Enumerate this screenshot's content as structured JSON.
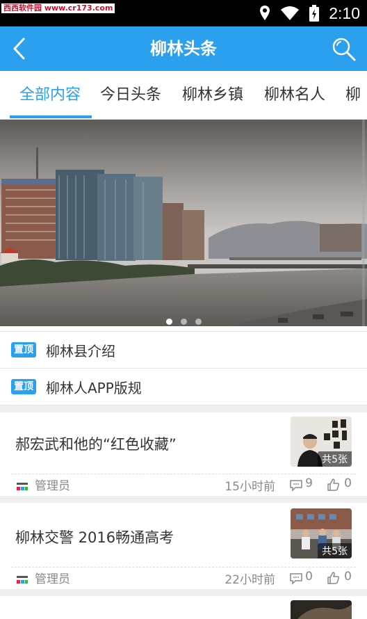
{
  "status_bar": {
    "watermark": "西西软件园 www.cr173.com",
    "time": "2:10"
  },
  "app_bar": {
    "title": "柳林头条",
    "back_icon": "chevron-left-icon",
    "search_icon": "search-icon"
  },
  "tabs": [
    {
      "label": "全部内容",
      "active": true
    },
    {
      "label": "今日头条",
      "active": false
    },
    {
      "label": "柳林乡镇",
      "active": false
    },
    {
      "label": "柳林名人",
      "active": false
    },
    {
      "label": "柳",
      "active": false
    }
  ],
  "banner": {
    "slide_count": 3,
    "active_slide": 1
  },
  "pinned": [
    {
      "badge": "置顶",
      "title": "柳林县介绍"
    },
    {
      "badge": "置顶",
      "title": "柳林人APP版规"
    }
  ],
  "news": [
    {
      "title": "郝宏武和他的“红色收藏”",
      "photo_count": "共5张",
      "author": "管理员",
      "time": "15小时前",
      "comments": "9",
      "likes": "0"
    },
    {
      "title": "柳林交警 2016畅通高考",
      "photo_count": "共5张",
      "author": "管理员",
      "time": "22小时前",
      "comments": "0",
      "likes": "0"
    }
  ],
  "colors": {
    "accent": "#2aa0ef",
    "badge": "#2aa0ef",
    "divider": "#efefef"
  }
}
